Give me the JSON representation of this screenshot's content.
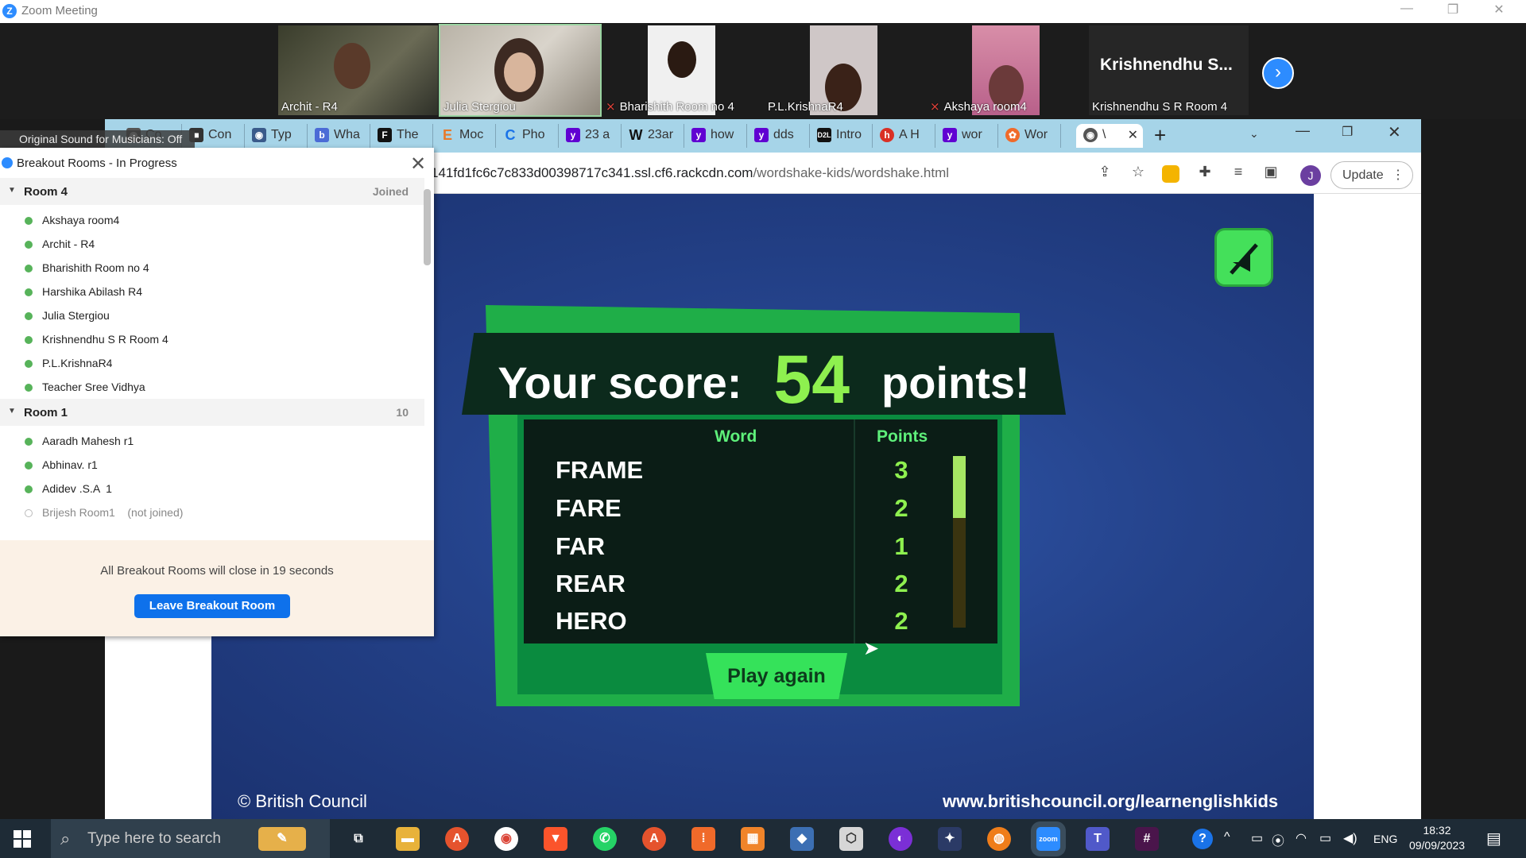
{
  "zoom_window": {
    "title": "Zoom Meeting",
    "original_sound": "Original Sound for Musicians: Off"
  },
  "participants": [
    {
      "label": "Archit - R4",
      "muted": false
    },
    {
      "label": "Julia Stergiou",
      "muted": false,
      "active_speaker": true
    },
    {
      "label": "Bharishith Room no 4",
      "muted": true
    },
    {
      "label": "P.L.KrishnaR4",
      "muted": false
    },
    {
      "label": "Akshaya room4",
      "muted": true
    },
    {
      "label": "Krishnendhu S R Room 4",
      "big_name": "Krishnendhu  S...",
      "muted": false
    }
  ],
  "browser": {
    "tabs": [
      {
        "icon": "globe-icon",
        "title": "Co"
      },
      {
        "icon": "app-icon",
        "title": "Con"
      },
      {
        "icon": "globe-icon",
        "title": "Typ"
      },
      {
        "icon": "bio-icon",
        "title": "Wha"
      },
      {
        "icon": "f-icon",
        "title": "The"
      },
      {
        "icon": "e-icon",
        "title": "Moc"
      },
      {
        "icon": "c-icon",
        "title": "Pho"
      },
      {
        "icon": "yahoo-icon",
        "title": "23 a"
      },
      {
        "icon": "wikipedia-icon",
        "title": "23ar"
      },
      {
        "icon": "yahoo-icon",
        "title": "how"
      },
      {
        "icon": "yahoo-icon",
        "title": "dds"
      },
      {
        "icon": "d2l-icon",
        "title": "Intro"
      },
      {
        "icon": "h-icon",
        "title": "A H"
      },
      {
        "icon": "yahoo-icon",
        "title": "wor"
      },
      {
        "icon": "wordshake-icon",
        "title": "Wor"
      },
      {
        "icon": "globe-icon",
        "title": "\\",
        "active": true
      }
    ],
    "url_host": "141fd1fc6c7c833d00398717c341.ssl.cf6.rackcdn.com",
    "url_path": "/wordshake-kids/wordshake.html",
    "update_label": "Update",
    "profile_initial": "J"
  },
  "game": {
    "score_prefix": "Your score:",
    "score_value": "54",
    "score_suffix": "points!",
    "col_word": "Word",
    "col_points": "Points",
    "words": [
      {
        "word": "FRAME",
        "points": "3"
      },
      {
        "word": "FARE",
        "points": "2"
      },
      {
        "word": "FAR",
        "points": "1"
      },
      {
        "word": "REAR",
        "points": "2"
      },
      {
        "word": "HERO",
        "points": "2"
      }
    ],
    "play_again": "Play again",
    "copyright": "© British Council",
    "site_url": "www.britishcouncil.org/learnenglishkids",
    "colors": {
      "accent": "#8ef04f",
      "card": "#1fae48",
      "bg": "#24428a"
    }
  },
  "breakout": {
    "title": "Breakout Rooms - In Progress",
    "rooms": [
      {
        "name": "Room 4",
        "status": "Joined",
        "members": [
          {
            "name": "Akshaya room4",
            "joined": true
          },
          {
            "name": "Archit - R4",
            "joined": true
          },
          {
            "name": "Bharishith Room no 4",
            "joined": true
          },
          {
            "name": "Harshika Abilash R4",
            "joined": true
          },
          {
            "name": "Julia Stergiou",
            "joined": true
          },
          {
            "name": "Krishnendhu S R Room 4",
            "joined": true
          },
          {
            "name": "P.L.KrishnaR4",
            "joined": true
          },
          {
            "name": "Teacher Sree Vidhya",
            "joined": true
          }
        ]
      },
      {
        "name": "Room 1",
        "status": "10",
        "members": [
          {
            "name": "Aaradh Mahesh r1",
            "joined": true
          },
          {
            "name": "Abhinav. r1",
            "joined": true
          },
          {
            "name": "Adidev .S.A  1",
            "joined": true
          },
          {
            "name": "Brijesh Room1    (not joined)",
            "joined": false
          }
        ]
      }
    ],
    "countdown": "All Breakout Rooms will close in 19 seconds",
    "leave_label": "Leave Breakout Room"
  },
  "taskbar": {
    "search_placeholder": "Type here to search",
    "language": "ENG",
    "time": "18:32",
    "date": "09/09/2023"
  }
}
